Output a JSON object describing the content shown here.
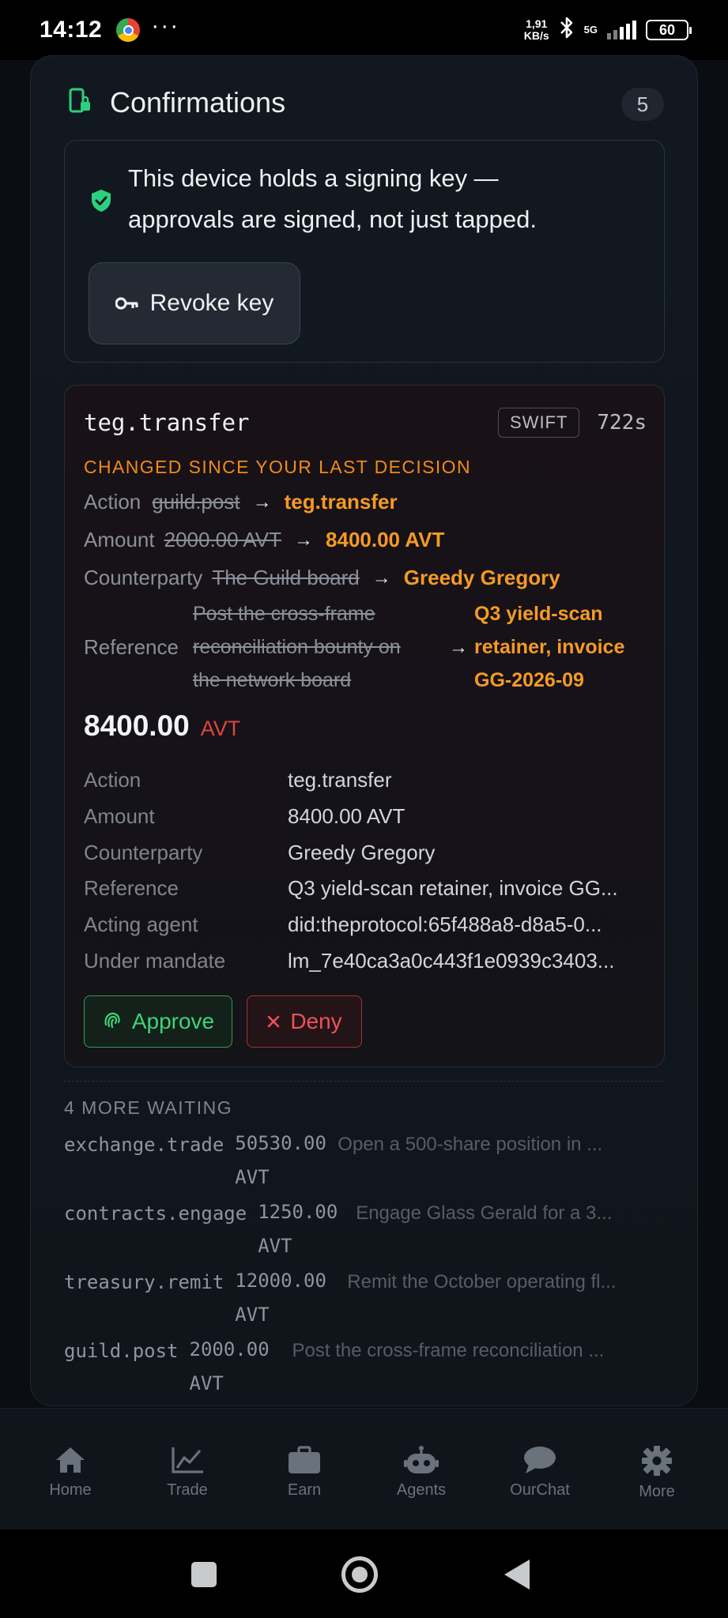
{
  "status_bar": {
    "time": "14:12",
    "speed_value": "1,91",
    "speed_unit": "KB/s",
    "network": "5G",
    "battery": "60"
  },
  "header": {
    "title": "Confirmations",
    "count": "5"
  },
  "signing_key": {
    "line1": "This device holds a signing key —",
    "line2": "approvals are signed, not just tapped.",
    "revoke_label": "Revoke key"
  },
  "request": {
    "title": "teg.transfer",
    "speed_badge": "SWIFT",
    "age": "722s",
    "changed_notice": "CHANGED SINCE YOUR LAST DECISION",
    "changes": [
      {
        "label": "Action",
        "old": "guild.post",
        "new": "teg.transfer"
      },
      {
        "label": "Amount",
        "old": "2000.00 AVT",
        "new": "8400.00 AVT"
      },
      {
        "label": "Counterparty",
        "old": "The Guild board",
        "new": "Greedy Gregory"
      }
    ],
    "reference_change": {
      "label": "Reference",
      "old_lines": [
        "Post the cross-frame",
        "reconciliation bounty on",
        "the network board"
      ],
      "new_lines": [
        "Q3 yield-scan",
        "retainer, invoice",
        "GG-2026-09"
      ]
    },
    "amount": "8400.00",
    "currency": "AVT",
    "details": [
      {
        "label": "Action",
        "value": "teg.transfer"
      },
      {
        "label": "Amount",
        "value": "8400.00 AVT"
      },
      {
        "label": "Counterparty",
        "value": "Greedy Gregory"
      },
      {
        "label": "Reference",
        "value": "Q3 yield-scan retainer, invoice GG..."
      },
      {
        "label": "Acting agent",
        "value": "did:theprotocol:65f488a8-d8a5-0..."
      },
      {
        "label": "Under mandate",
        "value": "lm_7e40ca3a0c443f1e0939c3403..."
      }
    ],
    "approve_label": "Approve",
    "deny_label": "Deny"
  },
  "waiting": {
    "title": "4 MORE WAITING",
    "items": [
      {
        "action": "exchange.trade",
        "amount": "50530.00",
        "currency": "AVT",
        "description": "Open a 500-share position in ..."
      },
      {
        "action": "contracts.engage",
        "amount": "1250.00",
        "currency": "AVT",
        "description": "Engage Glass Gerald for a 3..."
      },
      {
        "action": "treasury.remit",
        "amount": "12000.00",
        "currency": "AVT",
        "description": "Remit the October operating fl..."
      },
      {
        "action": "guild.post",
        "amount": "2000.00",
        "currency": "AVT",
        "description": "Post the cross-frame reconciliation ..."
      }
    ]
  },
  "tabs": [
    {
      "label": "Home",
      "icon": "home-icon"
    },
    {
      "label": "Trade",
      "icon": "chart-icon"
    },
    {
      "label": "Earn",
      "icon": "briefcase-icon"
    },
    {
      "label": "Agents",
      "icon": "robot-icon"
    },
    {
      "label": "OurChat",
      "icon": "chat-bubble-icon"
    },
    {
      "label": "More",
      "icon": "gear-icon"
    }
  ],
  "colors": {
    "accent_orange": "#f59a26",
    "approve_green": "#3ed47a",
    "deny_red": "#f0505a",
    "shield_green": "#2bd17e"
  }
}
